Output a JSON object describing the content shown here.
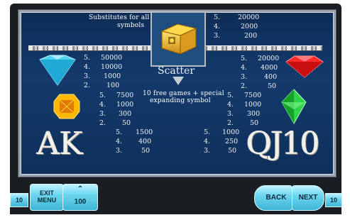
{
  "paytable": {
    "scatter": {
      "substitutes_text_line1": "Substitutes for all",
      "substitutes_text_line2": "symbols",
      "title": "Scatter",
      "desc_line1": "10 free games + special",
      "desc_line2": "expanding symbol",
      "payouts": [
        {
          "n": "5.",
          "v": "20000"
        },
        {
          "n": "4.",
          "v": "2000"
        },
        {
          "n": "3.",
          "v": "200"
        }
      ]
    },
    "blue_gem": [
      {
        "n": "5.",
        "v": "50000"
      },
      {
        "n": "4.",
        "v": "10000"
      },
      {
        "n": "3.",
        "v": "1000"
      },
      {
        "n": "2.",
        "v": "100"
      }
    ],
    "red_gem": [
      {
        "n": "5.",
        "v": "20000"
      },
      {
        "n": "4.",
        "v": "4000"
      },
      {
        "n": "3.",
        "v": "400"
      },
      {
        "n": "2.",
        "v": "50"
      }
    ],
    "orange_gem": [
      {
        "n": "5.",
        "v": "7500"
      },
      {
        "n": "4.",
        "v": "1000"
      },
      {
        "n": "3.",
        "v": "300"
      },
      {
        "n": "2.",
        "v": "50"
      }
    ],
    "green_gem": [
      {
        "n": "5.",
        "v": "7500"
      },
      {
        "n": "4.",
        "v": "1000"
      },
      {
        "n": "3.",
        "v": "300"
      },
      {
        "n": "2.",
        "v": "50"
      }
    ],
    "ak": {
      "letters": "AK",
      "payouts": [
        {
          "n": "5.",
          "v": "1500"
        },
        {
          "n": "4.",
          "v": "400"
        },
        {
          "n": "3.",
          "v": "50"
        }
      ]
    },
    "qj10": {
      "letters": "QJ10",
      "payouts": [
        {
          "n": "5.",
          "v": "1000"
        },
        {
          "n": "4.",
          "v": "250"
        },
        {
          "n": "3.",
          "v": "50"
        }
      ]
    }
  },
  "controls": {
    "left_value": "10",
    "exit_menu_line1": "EXIT",
    "exit_menu_line2": "MENU",
    "bet_value": "100",
    "back_label": "BACK",
    "next_label": "NEXT",
    "right_value": "10"
  },
  "colors": {
    "panel_bg": "#133a6b",
    "button_cyan": "#6dd6ef"
  }
}
